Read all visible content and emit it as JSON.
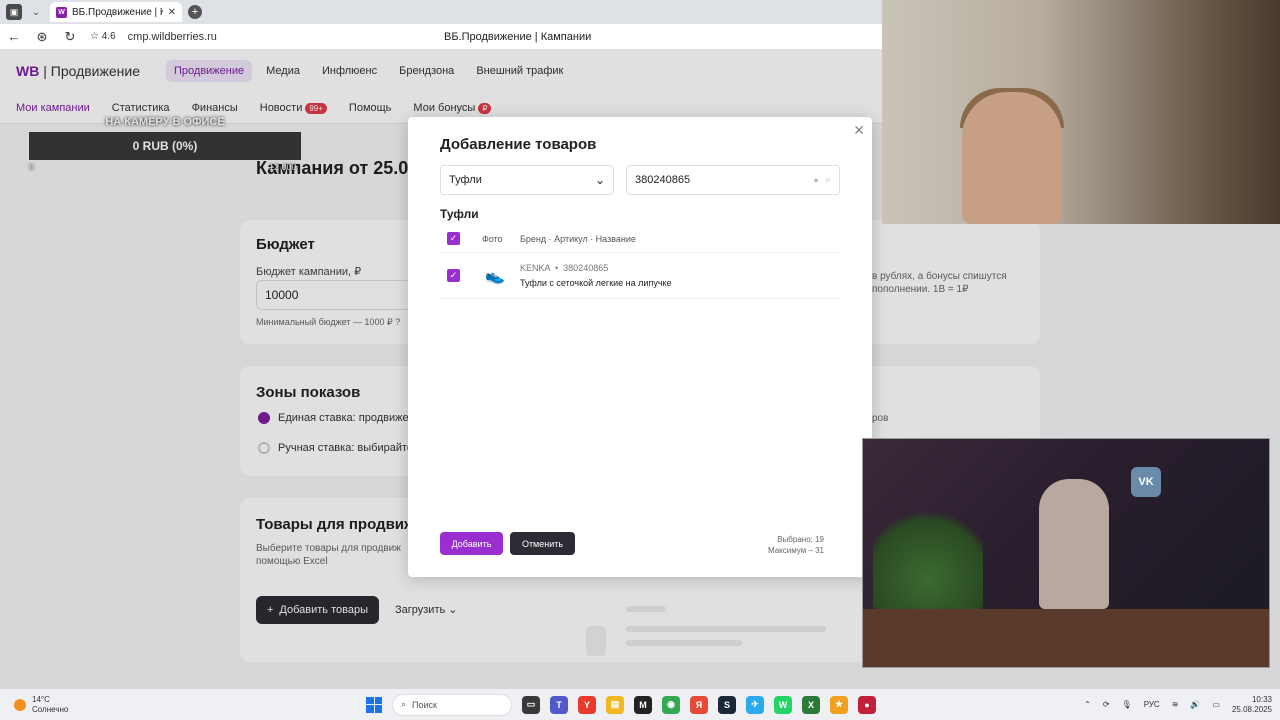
{
  "browser": {
    "tab_title": "ВБ.Продвижение | Кам",
    "rating": "4.6",
    "url": "cmp.wildberries.ru",
    "page_title": "ВБ.Продвижение | Кампании"
  },
  "header": {
    "logo_wb": "WB",
    "logo_text": "Продвижение",
    "nav": [
      "Продвижение",
      "Медиа",
      "Инфлюенс",
      "Брендзона",
      "Внешний трафик"
    ]
  },
  "subnav": {
    "items": [
      "Мои кампании",
      "Статистика",
      "Финансы",
      "Новости",
      "Помощь",
      "Мои бонусы"
    ],
    "news_badge": "99+",
    "bonus_badge": "₽"
  },
  "stream_overlay": {
    "title": "НА КАМЕРУ В ОФИСЕ",
    "amount": "0 RUB (0%)",
    "start": "0",
    "goal": "12 000"
  },
  "campaign": {
    "title": "Кампания от 25.0"
  },
  "budget": {
    "title": "Бюджет",
    "field_label": "Бюджет кампании, ₽",
    "value": "10000",
    "hint": "Минимальный бюджет — 1000 ₽",
    "side_note_1": "в рублях, а бонусы спишутся",
    "side_note_2": "пополнении. 1В = 1₽"
  },
  "zones": {
    "title": "Зоны показов",
    "option1": "Единая ставка: продвижен",
    "option2": "Ручная ставка: выбирайте",
    "side_note": "ров"
  },
  "products": {
    "title": "Товары для продвиж",
    "desc_1": "Выберите товары для продвиж",
    "desc_2": "помощью Excel",
    "add_button": "Добавить товары",
    "upload_button": "Загрузить"
  },
  "modal": {
    "title": "Добавление товаров",
    "category": "Туфли",
    "search_value": "380240865",
    "group_title": "Туфли",
    "col_photo": "Фото",
    "col_info": "Бренд · Артикул · Название",
    "items": [
      {
        "brand": "KENKA",
        "article": "380240865",
        "name": "Туфли с сеточкой легкие на липучке"
      }
    ],
    "add_button": "Добавить",
    "cancel_button": "Отменить",
    "selected": "Выбрано: 19",
    "maximum": "Максимум – 31"
  },
  "webcam": {
    "vk": "VK"
  },
  "taskbar": {
    "temp": "14°C",
    "weather": "Солнечно",
    "search": "Поиск",
    "lang": "РУС",
    "time": "10:33",
    "date": "25.08.2025"
  }
}
